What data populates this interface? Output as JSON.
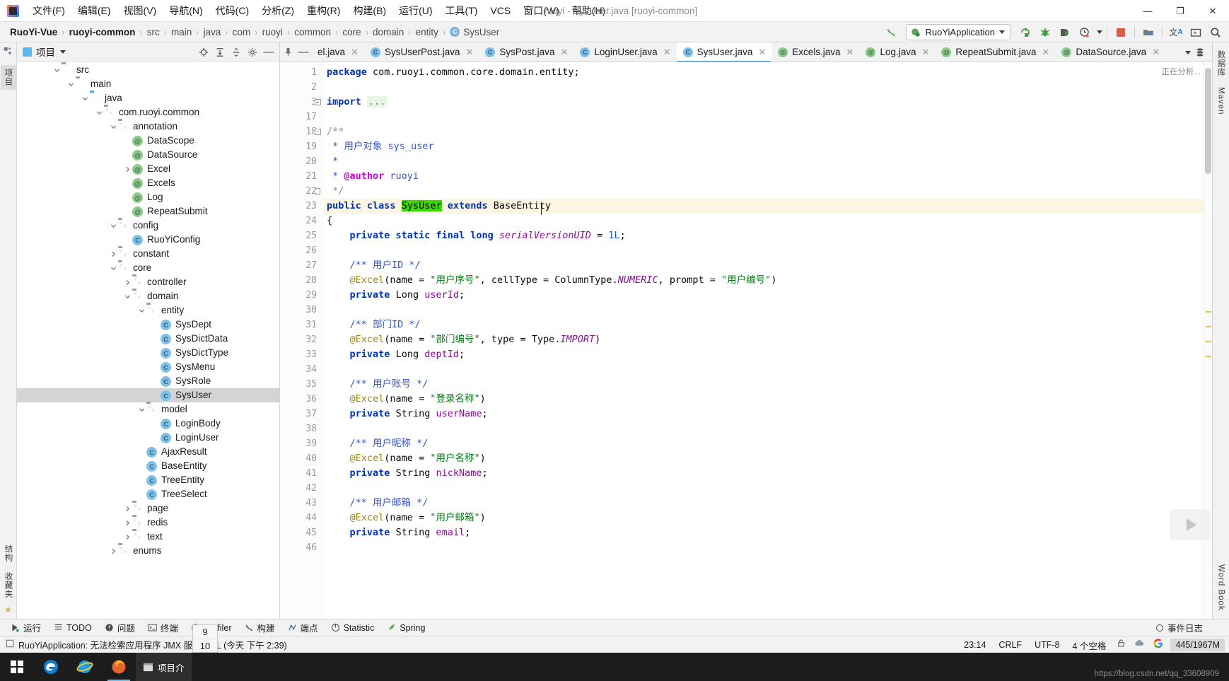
{
  "window": {
    "title": "ruoyi - SysUser.java [ruoyi-common]",
    "minimize": "—",
    "maximize": "❐",
    "close": "✕"
  },
  "menubar": {
    "items": [
      {
        "label": "文件(F)",
        "name": "menu-file"
      },
      {
        "label": "编辑(E)",
        "name": "menu-edit"
      },
      {
        "label": "视图(V)",
        "name": "menu-view"
      },
      {
        "label": "导航(N)",
        "name": "menu-navigate"
      },
      {
        "label": "代码(C)",
        "name": "menu-code"
      },
      {
        "label": "分析(Z)",
        "name": "menu-analyze"
      },
      {
        "label": "重构(R)",
        "name": "menu-refactor"
      },
      {
        "label": "构建(B)",
        "name": "menu-build"
      },
      {
        "label": "运行(U)",
        "name": "menu-run"
      },
      {
        "label": "工具(T)",
        "name": "menu-tools"
      },
      {
        "label": "VCS",
        "name": "menu-vcs"
      },
      {
        "label": "窗口(W)",
        "name": "menu-window"
      },
      {
        "label": "帮助(H)",
        "name": "menu-help"
      }
    ]
  },
  "breadcrumb": {
    "separator": "›",
    "items": [
      {
        "label": "RuoYi-Vue",
        "bold": true,
        "icon": null
      },
      {
        "label": "ruoyi-common",
        "bold": true,
        "icon": null
      },
      {
        "label": "src",
        "bold": false,
        "icon": null
      },
      {
        "label": "main",
        "bold": false,
        "icon": null
      },
      {
        "label": "java",
        "bold": false,
        "icon": null
      },
      {
        "label": "com",
        "bold": false,
        "icon": null
      },
      {
        "label": "ruoyi",
        "bold": false,
        "icon": null
      },
      {
        "label": "common",
        "bold": false,
        "icon": null
      },
      {
        "label": "core",
        "bold": false,
        "icon": null
      },
      {
        "label": "domain",
        "bold": false,
        "icon": null
      },
      {
        "label": "entity",
        "bold": false,
        "icon": null
      },
      {
        "label": "SysUser",
        "bold": false,
        "icon": "C"
      }
    ]
  },
  "toolbar": {
    "run_configuration": "RuoYiApplication",
    "icons": [
      {
        "name": "build-hammer-icon",
        "glyph": "⚒"
      },
      {
        "name": "rerun-icon",
        "glyph": "↻"
      },
      {
        "name": "debug-icon",
        "glyph": "ὁE"
      },
      {
        "name": "run-with-coverage-icon",
        "glyph": "▶"
      },
      {
        "name": "profiler-icon",
        "glyph": "◴"
      },
      {
        "name": "stop-icon",
        "glyph": "■"
      },
      {
        "name": "project-structure-icon",
        "glyph": "▤"
      },
      {
        "name": "translate-icon",
        "glyph": "文A"
      },
      {
        "name": "terminal-icon",
        "glyph": "▶"
      },
      {
        "name": "search-everywhere-icon",
        "glyph": "⌕"
      }
    ]
  },
  "project_panel": {
    "title": "项目",
    "header_icons": [
      {
        "name": "locate-icon"
      },
      {
        "name": "expand-all-icon"
      },
      {
        "name": "collapse-all-icon"
      },
      {
        "name": "settings-gear-icon"
      },
      {
        "name": "hide-panel-icon"
      }
    ],
    "tree": [
      {
        "label": "src",
        "depth": 2,
        "icon": "folder-gray",
        "arrow": "down",
        "selected": false
      },
      {
        "label": "main",
        "depth": 3,
        "icon": "folder-gray",
        "arrow": "down",
        "selected": false
      },
      {
        "label": "java",
        "depth": 4,
        "icon": "folder-blue",
        "arrow": "down",
        "selected": false
      },
      {
        "label": "com.ruoyi.common",
        "depth": 5,
        "icon": "package",
        "arrow": "down",
        "selected": false
      },
      {
        "label": "annotation",
        "depth": 6,
        "icon": "package",
        "arrow": "down",
        "selected": false
      },
      {
        "label": "DataScope",
        "depth": 7,
        "icon": "annotation",
        "arrow": "none",
        "selected": false
      },
      {
        "label": "DataSource",
        "depth": 7,
        "icon": "annotation",
        "arrow": "none",
        "selected": false
      },
      {
        "label": "Excel",
        "depth": 7,
        "icon": "annotation",
        "arrow": "right",
        "selected": false
      },
      {
        "label": "Excels",
        "depth": 7,
        "icon": "annotation",
        "arrow": "none",
        "selected": false
      },
      {
        "label": "Log",
        "depth": 7,
        "icon": "annotation",
        "arrow": "none",
        "selected": false
      },
      {
        "label": "RepeatSubmit",
        "depth": 7,
        "icon": "annotation",
        "arrow": "none",
        "selected": false
      },
      {
        "label": "config",
        "depth": 6,
        "icon": "package",
        "arrow": "down",
        "selected": false
      },
      {
        "label": "RuoYiConfig",
        "depth": 7,
        "icon": "class",
        "arrow": "none",
        "selected": false
      },
      {
        "label": "constant",
        "depth": 6,
        "icon": "package",
        "arrow": "right",
        "selected": false
      },
      {
        "label": "core",
        "depth": 6,
        "icon": "package",
        "arrow": "down",
        "selected": false
      },
      {
        "label": "controller",
        "depth": 7,
        "icon": "package",
        "arrow": "right",
        "selected": false
      },
      {
        "label": "domain",
        "depth": 7,
        "icon": "package",
        "arrow": "down",
        "selected": false
      },
      {
        "label": "entity",
        "depth": 8,
        "icon": "package",
        "arrow": "down",
        "selected": false
      },
      {
        "label": "SysDept",
        "depth": 9,
        "icon": "class",
        "arrow": "none",
        "selected": false
      },
      {
        "label": "SysDictData",
        "depth": 9,
        "icon": "class",
        "arrow": "none",
        "selected": false
      },
      {
        "label": "SysDictType",
        "depth": 9,
        "icon": "class",
        "arrow": "none",
        "selected": false
      },
      {
        "label": "SysMenu",
        "depth": 9,
        "icon": "class",
        "arrow": "none",
        "selected": false
      },
      {
        "label": "SysRole",
        "depth": 9,
        "icon": "class",
        "arrow": "none",
        "selected": false
      },
      {
        "label": "SysUser",
        "depth": 9,
        "icon": "class",
        "arrow": "none",
        "selected": true
      },
      {
        "label": "model",
        "depth": 8,
        "icon": "package",
        "arrow": "down",
        "selected": false
      },
      {
        "label": "LoginBody",
        "depth": 9,
        "icon": "class",
        "arrow": "none",
        "selected": false
      },
      {
        "label": "LoginUser",
        "depth": 9,
        "icon": "class",
        "arrow": "none",
        "selected": false
      },
      {
        "label": "AjaxResult",
        "depth": 8,
        "icon": "class",
        "arrow": "none",
        "selected": false
      },
      {
        "label": "BaseEntity",
        "depth": 8,
        "icon": "class",
        "arrow": "none",
        "selected": false
      },
      {
        "label": "TreeEntity",
        "depth": 8,
        "icon": "class",
        "arrow": "none",
        "selected": false
      },
      {
        "label": "TreeSelect",
        "depth": 8,
        "icon": "class",
        "arrow": "none",
        "selected": false
      },
      {
        "label": "page",
        "depth": 7,
        "icon": "package",
        "arrow": "right",
        "selected": false
      },
      {
        "label": "redis",
        "depth": 7,
        "icon": "package",
        "arrow": "right",
        "selected": false
      },
      {
        "label": "text",
        "depth": 7,
        "icon": "package",
        "arrow": "right",
        "selected": false
      },
      {
        "label": "enums",
        "depth": 6,
        "icon": "package",
        "arrow": "right",
        "selected": false
      }
    ]
  },
  "editor_tabs": {
    "overflow_more": "⌄",
    "tabs": [
      {
        "label": "el.java",
        "icon": "none",
        "active": false
      },
      {
        "label": "SysUserPost.java",
        "icon": "class",
        "active": false
      },
      {
        "label": "SysPost.java",
        "icon": "class",
        "active": false
      },
      {
        "label": "LoginUser.java",
        "icon": "class",
        "active": false
      },
      {
        "label": "SysUser.java",
        "icon": "class",
        "active": true
      },
      {
        "label": "Excels.java",
        "icon": "annotation",
        "active": false
      },
      {
        "label": "Log.java",
        "icon": "annotation",
        "active": false
      },
      {
        "label": "RepeatSubmit.java",
        "icon": "annotation",
        "active": false
      },
      {
        "label": "DataSource.java",
        "icon": "annotation",
        "active": false
      }
    ]
  },
  "editor": {
    "analyzing_label": "正在分析...",
    "lines": [
      {
        "num": "1",
        "fold": "none",
        "html": "<span class=\"kw\">package</span> <span class=\"plain\">com.ruoyi.common.core.domain.entity;</span>"
      },
      {
        "num": "2",
        "fold": "none",
        "html": ""
      },
      {
        "num": "3",
        "fold": "plus",
        "html": "<span class=\"kw\">import</span> <span class=\"import-dots\">...</span>"
      },
      {
        "num": "17",
        "fold": "none",
        "html": ""
      },
      {
        "num": "18",
        "fold": "minus",
        "html": "<span class=\"cmt\">/**</span>"
      },
      {
        "num": "19",
        "fold": "none",
        "html": "<span class=\"jdoc\"> * 用户对象 sys_user</span>"
      },
      {
        "num": "20",
        "fold": "none",
        "html": "<span class=\"jdoc\"> *</span>"
      },
      {
        "num": "21",
        "fold": "none",
        "html": "<span class=\"jdoc\"> * </span><span class=\"jdoc-tag\">@author</span><span class=\"jdoc\"> ruoyi</span>"
      },
      {
        "num": "22",
        "fold": "end",
        "html": "<span class=\"cmt\"> */</span>"
      },
      {
        "num": "23",
        "fold": "none",
        "hl": true,
        "html": "<span class=\"kw\">public class</span> <span class=\"hlgreen\">SysUser</span> <span class=\"kw\">extends</span> <span class=\"plain\">BaseEntity</span>"
      },
      {
        "num": "24",
        "fold": "none",
        "html": "<span class=\"plain\">{</span>"
      },
      {
        "num": "25",
        "fold": "none",
        "html": "    <span class=\"kw\">private static final</span> <span class=\"kw\">long</span> <span class=\"ital\">serialVersionUID</span> <span class=\"plain\">=</span> <span class=\"num\">1L</span><span class=\"plain\">;</span>"
      },
      {
        "num": "26",
        "fold": "none",
        "html": ""
      },
      {
        "num": "27",
        "fold": "none",
        "html": "    <span class=\"jdoc\">/** 用户ID */</span>"
      },
      {
        "num": "28",
        "fold": "none",
        "html": "    <span class=\"ann\">@Excel</span><span class=\"plain\">(name = </span><span class=\"str\">\"用户序号\"</span><span class=\"plain\">, cellType = ColumnType.</span><span class=\"ital\">NUMERIC</span><span class=\"plain\">, prompt = </span><span class=\"str\">\"用户编号\"</span><span class=\"plain\">)</span>"
      },
      {
        "num": "29",
        "fold": "none",
        "html": "    <span class=\"kw\">private</span> <span class=\"plain\">Long</span> <span class=\"fld\">userId</span><span class=\"plain\">;</span>"
      },
      {
        "num": "30",
        "fold": "none",
        "html": ""
      },
      {
        "num": "31",
        "fold": "none",
        "html": "    <span class=\"jdoc\">/** 部门ID */</span>"
      },
      {
        "num": "32",
        "fold": "none",
        "html": "    <span class=\"ann\">@Excel</span><span class=\"plain\">(name = </span><span class=\"str\">\"部门编号\"</span><span class=\"plain\">, type = Type.</span><span class=\"ital\">IMPORT</span><span class=\"plain\">)</span>"
      },
      {
        "num": "33",
        "fold": "none",
        "html": "    <span class=\"kw\">private</span> <span class=\"plain\">Long</span> <span class=\"fld\">deptId</span><span class=\"plain\">;</span>"
      },
      {
        "num": "34",
        "fold": "none",
        "html": ""
      },
      {
        "num": "35",
        "fold": "none",
        "html": "    <span class=\"jdoc\">/** 用户账号 */</span>"
      },
      {
        "num": "36",
        "fold": "none",
        "html": "    <span class=\"ann\">@Excel</span><span class=\"plain\">(name = </span><span class=\"str\">\"登录名称\"</span><span class=\"plain\">)</span>"
      },
      {
        "num": "37",
        "fold": "none",
        "html": "    <span class=\"kw\">private</span> <span class=\"plain\">String</span> <span class=\"fld\">userName</span><span class=\"plain\">;</span>"
      },
      {
        "num": "38",
        "fold": "none",
        "html": ""
      },
      {
        "num": "39",
        "fold": "none",
        "html": "    <span class=\"jdoc\">/** 用户昵称 */</span>"
      },
      {
        "num": "40",
        "fold": "none",
        "html": "    <span class=\"ann\">@Excel</span><span class=\"plain\">(name = </span><span class=\"str\">\"用户名称\"</span><span class=\"plain\">)</span>"
      },
      {
        "num": "41",
        "fold": "none",
        "html": "    <span class=\"kw\">private</span> <span class=\"plain\">String</span> <span class=\"fld\">nickName</span><span class=\"plain\">;</span>"
      },
      {
        "num": "42",
        "fold": "none",
        "html": ""
      },
      {
        "num": "43",
        "fold": "none",
        "html": "    <span class=\"jdoc\">/** 用户邮箱 */</span>"
      },
      {
        "num": "44",
        "fold": "none",
        "html": "    <span class=\"ann\">@Excel</span><span class=\"plain\">(name = </span><span class=\"str\">\"用户邮箱\"</span><span class=\"plain\">)</span>"
      },
      {
        "num": "45",
        "fold": "none",
        "html": "    <span class=\"kw\">private</span> <span class=\"plain\">String</span> <span class=\"fld\">email</span><span class=\"plain\">;</span>"
      },
      {
        "num": "46",
        "fold": "none",
        "html": ""
      }
    ]
  },
  "left_strip": {
    "top": "项目",
    "bottom_1": "结构",
    "bottom_2": "收藏夹"
  },
  "right_strip": {
    "top": "数据库",
    "mid": "Maven",
    "bottom": "Word Book"
  },
  "bottom_toolbar": {
    "items": [
      {
        "label": "运行",
        "icon": "run-icon"
      },
      {
        "label": "TODO",
        "icon": "todo-icon"
      },
      {
        "label": "问题",
        "icon": "problems-icon"
      },
      {
        "label": "终端",
        "icon": "terminal-icon"
      },
      {
        "label": "Profiler",
        "icon": "profiler-icon"
      },
      {
        "label": "构建",
        "icon": "build-icon"
      },
      {
        "label": "端点",
        "icon": "endpoints-icon"
      },
      {
        "label": "Statistic",
        "icon": "statistic-icon"
      },
      {
        "label": "Spring",
        "icon": "spring-leaf-icon"
      }
    ],
    "event_log": "事件日志"
  },
  "statusbar": {
    "message": "RuoYiApplication: 无法检索应用程序 JMX 服务 URL (今天 下午 2:39)",
    "caret_position": "23:14",
    "line_separator": "CRLF",
    "encoding": "UTF-8",
    "indent": "4 个空格",
    "lock_icon": "lock-icon",
    "cloud_icon": "cloud-icon",
    "google_icon": "google-icon",
    "memory": "445/1967M"
  },
  "taskbar": {
    "start": "start-button",
    "apps": [
      "edge-icon",
      "ie-icon",
      "firefox-icon"
    ],
    "window_label": "项目介",
    "watermark": "https://blog.csdn.net/qq_33608909",
    "popup_numbers": [
      "9",
      "10"
    ]
  }
}
